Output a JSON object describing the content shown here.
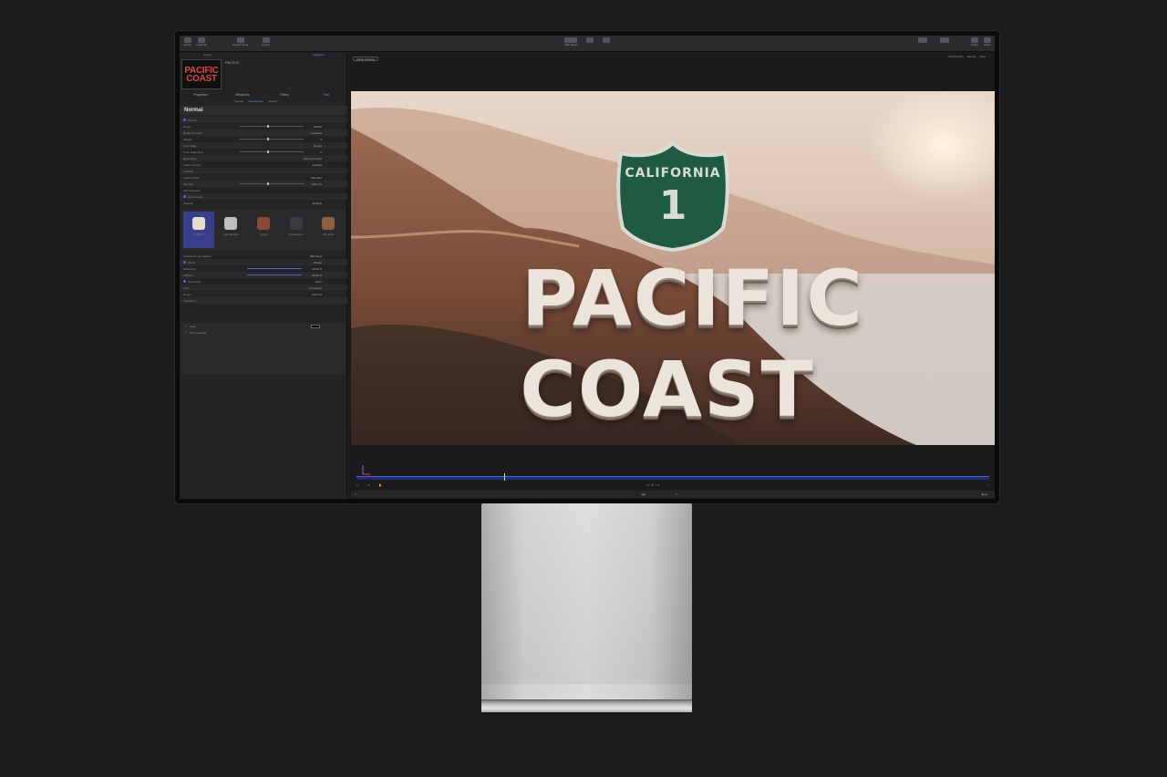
{
  "toolbar": {
    "left_buttons": [
      "Library",
      "Inspector",
      "Project Pane",
      "Layers"
    ],
    "center_label": "Add Object",
    "right_buttons": [
      "Share",
      "Share"
    ]
  },
  "library": {
    "tabs": [
      "Library",
      "",
      "Inspector"
    ],
    "preview_title_line1": "PACIFIC",
    "preview_title_line2": "COAST",
    "preview_name": "PACIFIC"
  },
  "inspector": {
    "tabs": [
      "Properties",
      "Behaviors",
      "Filters",
      "Text"
    ],
    "active_tab": "Text",
    "sub_tabs": [
      "Format",
      "Appearance",
      "Layout"
    ],
    "active_sub_tab": "Appearance",
    "section_title": "Normal",
    "rows": [
      {
        "label": "3D Text",
        "value": "",
        "check": true
      },
      {
        "label": "Depth",
        "value": "0.0625",
        "slider": true
      },
      {
        "label": "Depth Direction",
        "value": "Centered"
      },
      {
        "label": "Weight",
        "value": "0",
        "slider": true
      },
      {
        "label": "Front Edge",
        "value": "Round"
      },
      {
        "label": "Front Edge Size",
        "value": "0",
        "slider": true
      },
      {
        "label": "Back Edge",
        "value": "Same As Front"
      },
      {
        "label": "Inside Corners",
        "value": "Straight"
      },
      {
        "label": "Lighting",
        "value": ""
      },
      {
        "label": "Lighting Style",
        "value": "Standard"
      },
      {
        "label": "Intensity",
        "value": "100.0 %",
        "slider": true
      },
      {
        "label": "Self Shadows",
        "value": ""
      },
      {
        "label": "Environment",
        "value": "",
        "check": true
      },
      {
        "label": "Material",
        "value": "Multiple"
      }
    ],
    "materials": [
      {
        "name": "Concrete",
        "color": "#e6dccb"
      },
      {
        "name": "Steel Brushed",
        "color": "#bfbfc2"
      },
      {
        "name": "Copper",
        "color": "#8a4a36"
      },
      {
        "name": "Smoked Glass",
        "color": "#3a3a40"
      },
      {
        "name": "Fine Wood",
        "color": "#8e5e3f"
      }
    ],
    "rows2": [
      {
        "label": "Substance: Foundation",
        "value": "Mild Steel"
      },
      {
        "label": "Finish",
        "value": "Plastic",
        "check": true
      },
      {
        "label": "Reflectivity",
        "value": "18.00 %",
        "bar": true
      },
      {
        "label": "Diffusion",
        "value": "28.00 %",
        "bar": true
      },
      {
        "label": "Distressed",
        "value": "Worn",
        "check": true
      },
      {
        "label": "Type",
        "value": "Limestone"
      },
      {
        "label": "Depth",
        "value": "100.0 %"
      },
      {
        "label": "Transform",
        "value": ""
      }
    ],
    "rows3": [
      {
        "label": "Glow",
        "value": ""
      },
      {
        "label": "Drop Shadow",
        "value": ""
      }
    ]
  },
  "viewer": {
    "camera_select": "Active Camera",
    "zoom_info": [
      "Fit 83% (Fit)",
      "Render",
      "View"
    ],
    "sign_top": "CALIFORNIA",
    "sign_num": "1",
    "title_line1": "PACIFIC",
    "title_line2": "COAST"
  },
  "colors": {
    "accent": "#4a63d6",
    "title_red": "#d64a3c",
    "shield_green": "#1f5a43"
  }
}
